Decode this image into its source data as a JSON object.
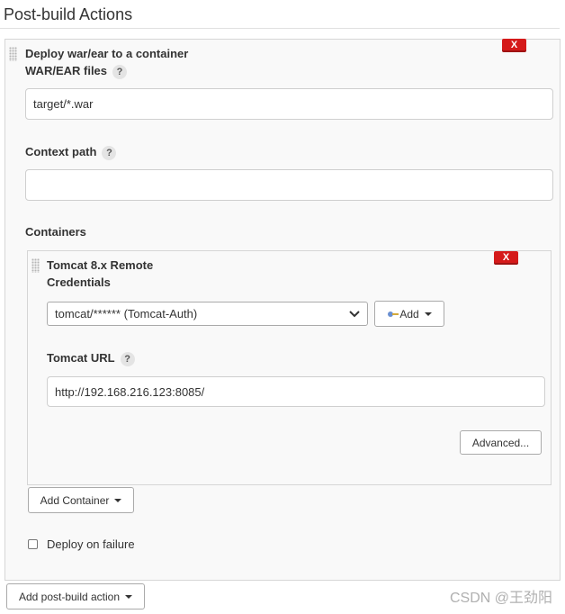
{
  "section": {
    "title": "Post-build Actions"
  },
  "deploy": {
    "title": "Deploy war/ear to a container",
    "remove_label": "X",
    "war_label": "WAR/EAR files",
    "war_value": "target/*.war",
    "context_label": "Context path",
    "context_value": "",
    "containers_label": "Containers",
    "help_glyph": "?"
  },
  "container": {
    "title": "Tomcat 8.x Remote",
    "remove_label": "X",
    "credentials_label": "Credentials",
    "credentials_value": "tomcat/****** (Tomcat-Auth)",
    "add_label": "Add",
    "url_label": "Tomcat URL",
    "url_value": "http://192.168.216.123:8085/",
    "advanced_label": "Advanced..."
  },
  "add_container_label": "Add Container",
  "deploy_on_failure_label": "Deploy on failure",
  "deploy_on_failure_checked": false,
  "add_post_build_label": "Add post-build action",
  "watermark": "CSDN @王劲阳",
  "colors": {
    "remove": "#d51a1a",
    "border": "#d6d6d6",
    "panel": "#f9f9f9"
  }
}
